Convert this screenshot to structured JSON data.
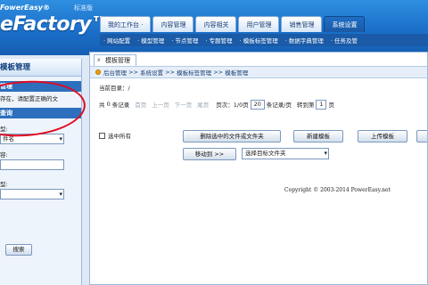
{
  "header": {
    "logo_top": "FowerEasy®",
    "logo_main": "eFactory™",
    "edition_badge": "标准版",
    "main_tabs": [
      {
        "label": "我的工作台 ·"
      },
      {
        "label": "内容管理"
      },
      {
        "label": "内容相关"
      },
      {
        "label": "用户管理"
      },
      {
        "label": "销售管理"
      },
      {
        "label": "系统设置"
      }
    ],
    "active_tab_index": 5,
    "sub_nav": [
      "· 网站配置",
      "· 模型管理",
      "· 节点管理",
      "· 专题管理",
      "· 模板标签管理",
      "· 数据字典管理",
      "· 任务及管"
    ]
  },
  "sidebar": {
    "title": "模板管理",
    "section1_head": "管理",
    "message": "存在，请配置正确的文",
    "section2_head": "查询",
    "field1_label": "型:",
    "field1_value": "件名",
    "field2_label": "容:",
    "field3_label": "型:",
    "field3_value": "",
    "search_button": "搜索"
  },
  "content": {
    "tab_label": "模板管理",
    "tab_close": "x",
    "breadcrumb": [
      "后台管理",
      "系统设置",
      "模板标签管理",
      "模板管理"
    ],
    "breadcrumb_sep": ">>",
    "current_dir": "当前目录：/",
    "pager": {
      "total_prefix": "共",
      "total_count": "0",
      "total_suffix": "条记录",
      "first": "首页",
      "prev": "上一页",
      "next": "下一页",
      "last": "尾页",
      "page_label": "页次：",
      "page_value": "1/0页",
      "per_page_value": "20",
      "per_page_suffix": "条记录/页",
      "goto_label": "转到第",
      "goto_value": "1",
      "goto_suffix": "页"
    },
    "select_all_label": "选中所有",
    "buttons": {
      "delete_selected": "删除选中的文件或文件夹",
      "create_template": "新建模板",
      "upload_template": "上传模板",
      "move_to": "移动到 >>"
    },
    "move_target_select": "选择目标文件夹",
    "copyright": "Copyright © 2003-2014 PowerEasy.net"
  },
  "colors": {
    "header_blue": "#1b6fc9",
    "annotation_red": "#e10b20"
  }
}
